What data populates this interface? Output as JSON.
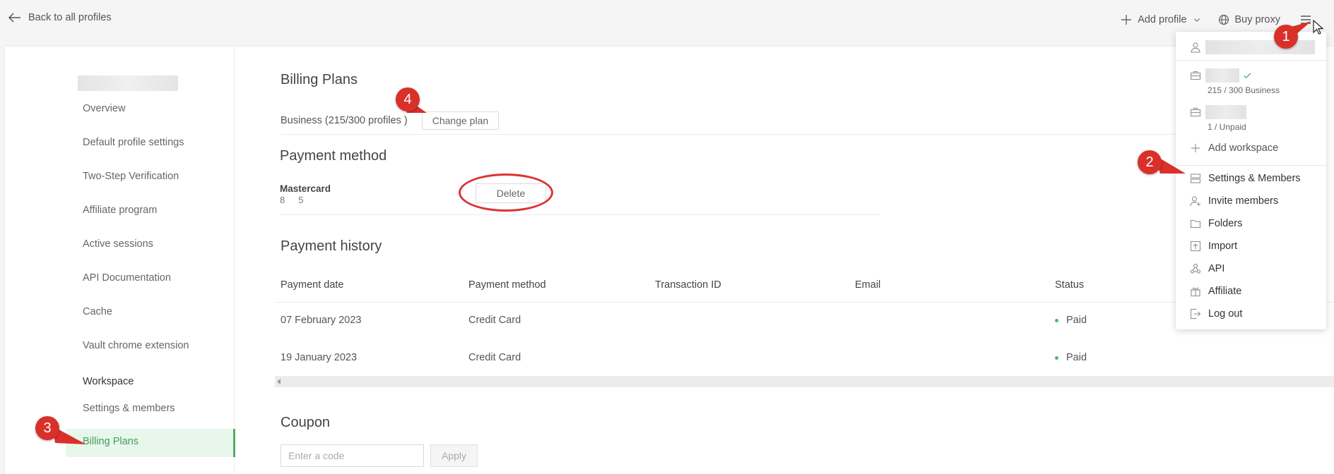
{
  "topbar": {
    "back_label": "Back to all profiles",
    "add_profile_label": "Add profile",
    "buy_proxy_label": "Buy proxy"
  },
  "sidebar": {
    "items": [
      {
        "label": "Overview"
      },
      {
        "label": "Default profile settings"
      },
      {
        "label": "Two-Step Verification"
      },
      {
        "label": "Affiliate program"
      },
      {
        "label": "Active sessions"
      },
      {
        "label": "API Documentation"
      },
      {
        "label": "Cache"
      },
      {
        "label": "Vault chrome extension"
      }
    ],
    "workspace_heading": "Workspace",
    "workspace_items": [
      {
        "label": "Settings & members"
      },
      {
        "label": "Billing Plans"
      }
    ]
  },
  "billing": {
    "title": "Billing Plans",
    "plan_text": "Business (215/300 profiles )",
    "change_plan_label": "Change plan"
  },
  "payment_method": {
    "title": "Payment method",
    "card_name": "Mastercard",
    "card_number": "8⠀⠀5",
    "delete_label": "Delete"
  },
  "payment_history": {
    "title": "Payment history",
    "columns": [
      "Payment date",
      "Payment method",
      "Transaction ID",
      "Email",
      "Status"
    ],
    "rows": [
      {
        "date": "07 February 2023",
        "method": "Credit Card",
        "transaction": "",
        "email": "",
        "status": "Paid"
      },
      {
        "date": "19 January 2023",
        "method": "Credit Card",
        "transaction": "",
        "email": "",
        "status": "Paid"
      }
    ]
  },
  "coupon": {
    "title": "Coupon",
    "placeholder": "Enter a code",
    "apply_label": "Apply"
  },
  "dropdown": {
    "workspaces": [
      {
        "sub": "215 / 300 Business",
        "active": true
      },
      {
        "sub": "1 / Unpaid",
        "active": false
      }
    ],
    "add_workspace_label": "Add workspace",
    "items": [
      {
        "label": "Settings & Members",
        "icon": "settings-icon"
      },
      {
        "label": "Invite members",
        "icon": "invite-icon"
      },
      {
        "label": "Folders",
        "icon": "folder-icon"
      },
      {
        "label": "Import",
        "icon": "import-icon"
      },
      {
        "label": "API",
        "icon": "api-icon"
      },
      {
        "label": "Affiliate",
        "icon": "affiliate-icon"
      },
      {
        "label": "Log out",
        "icon": "logout-icon"
      }
    ]
  },
  "annotations": [
    "1",
    "2",
    "3",
    "4"
  ],
  "colors": {
    "accent_green": "#4caf6a",
    "annotation_red": "#d9302a",
    "paid_dot": "#4cbf62"
  }
}
